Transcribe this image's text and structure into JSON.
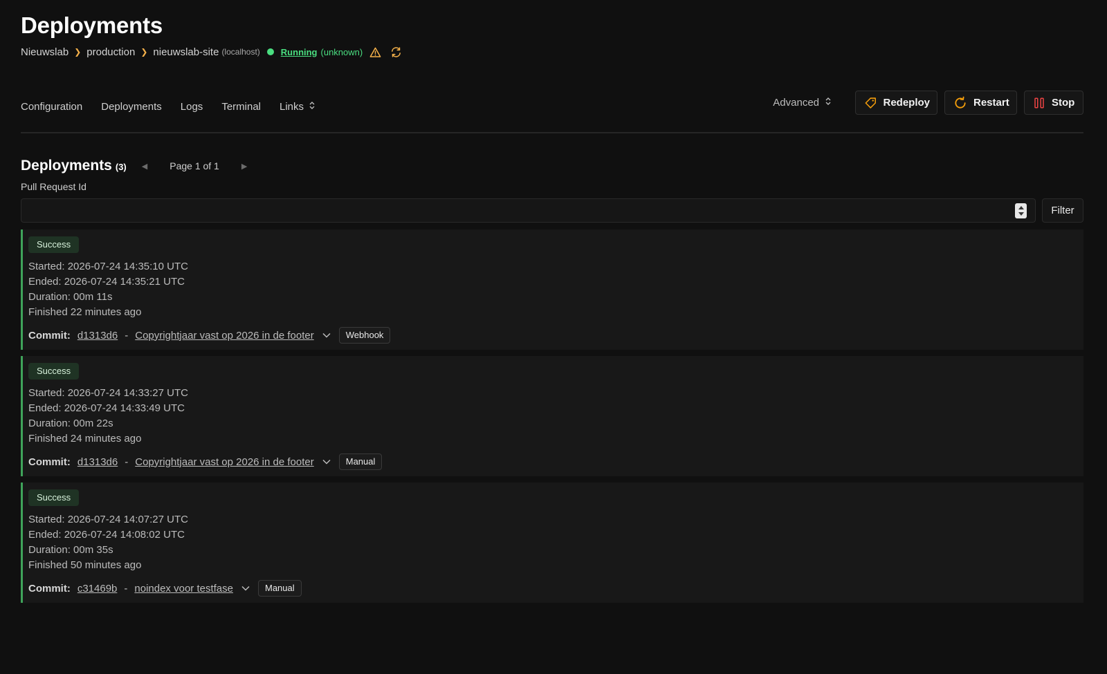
{
  "header": {
    "title": "Deployments",
    "breadcrumb": {
      "project": "Nieuwslab",
      "environment": "production",
      "service": "nieuwslab-site",
      "host": "(localhost)",
      "status": "Running",
      "health": "(unknown)"
    }
  },
  "tabs": {
    "configuration": "Configuration",
    "deployments": "Deployments",
    "logs": "Logs",
    "terminal": "Terminal",
    "links": "Links"
  },
  "actions": {
    "advanced": "Advanced",
    "redeploy": "Redeploy",
    "restart": "Restart",
    "stop": "Stop"
  },
  "section": {
    "title": "Deployments",
    "count": "(3)",
    "page_label": "Page 1 of 1"
  },
  "filter": {
    "label": "Pull Request Id",
    "value": "",
    "button": "Filter"
  },
  "commit_label": "Commit:",
  "deployments": [
    {
      "status": "Success",
      "started": "Started: 2026-07-24 14:35:10 UTC",
      "ended": "Ended: 2026-07-24 14:35:21 UTC",
      "duration": "Duration: 00m 11s",
      "finished": "Finished 22 minutes ago",
      "commit_hash": "d1313d6",
      "commit_message": "Copyrightjaar vast op 2026 in de footer",
      "trigger": "Webhook"
    },
    {
      "status": "Success",
      "started": "Started: 2026-07-24 14:33:27 UTC",
      "ended": "Ended: 2026-07-24 14:33:49 UTC",
      "duration": "Duration: 00m 22s",
      "finished": "Finished 24 minutes ago",
      "commit_hash": "d1313d6",
      "commit_message": "Copyrightjaar vast op 2026 in de footer",
      "trigger": "Manual"
    },
    {
      "status": "Success",
      "started": "Started: 2026-07-24 14:07:27 UTC",
      "ended": "Ended: 2026-07-24 14:08:02 UTC",
      "duration": "Duration: 00m 35s",
      "finished": "Finished 50 minutes ago",
      "commit_hash": "c31469b",
      "commit_message": "noindex voor testfase",
      "trigger": "Manual"
    }
  ],
  "colors": {
    "background": "#101010",
    "accent_running": "#4ade80",
    "breadcrumb_chevron": "#f5b14a",
    "success_border": "#3fa35a",
    "stop_icon": "#ef4444",
    "redeploy_icon": "#f59e0b"
  },
  "icons": {
    "breadcrumb_separator": "chevron-right-icon",
    "status_dot": "status-dot-icon",
    "warning": "warning-triangle-icon",
    "refresh": "refresh-icon",
    "redeploy": "tag-icon",
    "restart": "rotate-icon",
    "stop": "pause-icon"
  }
}
